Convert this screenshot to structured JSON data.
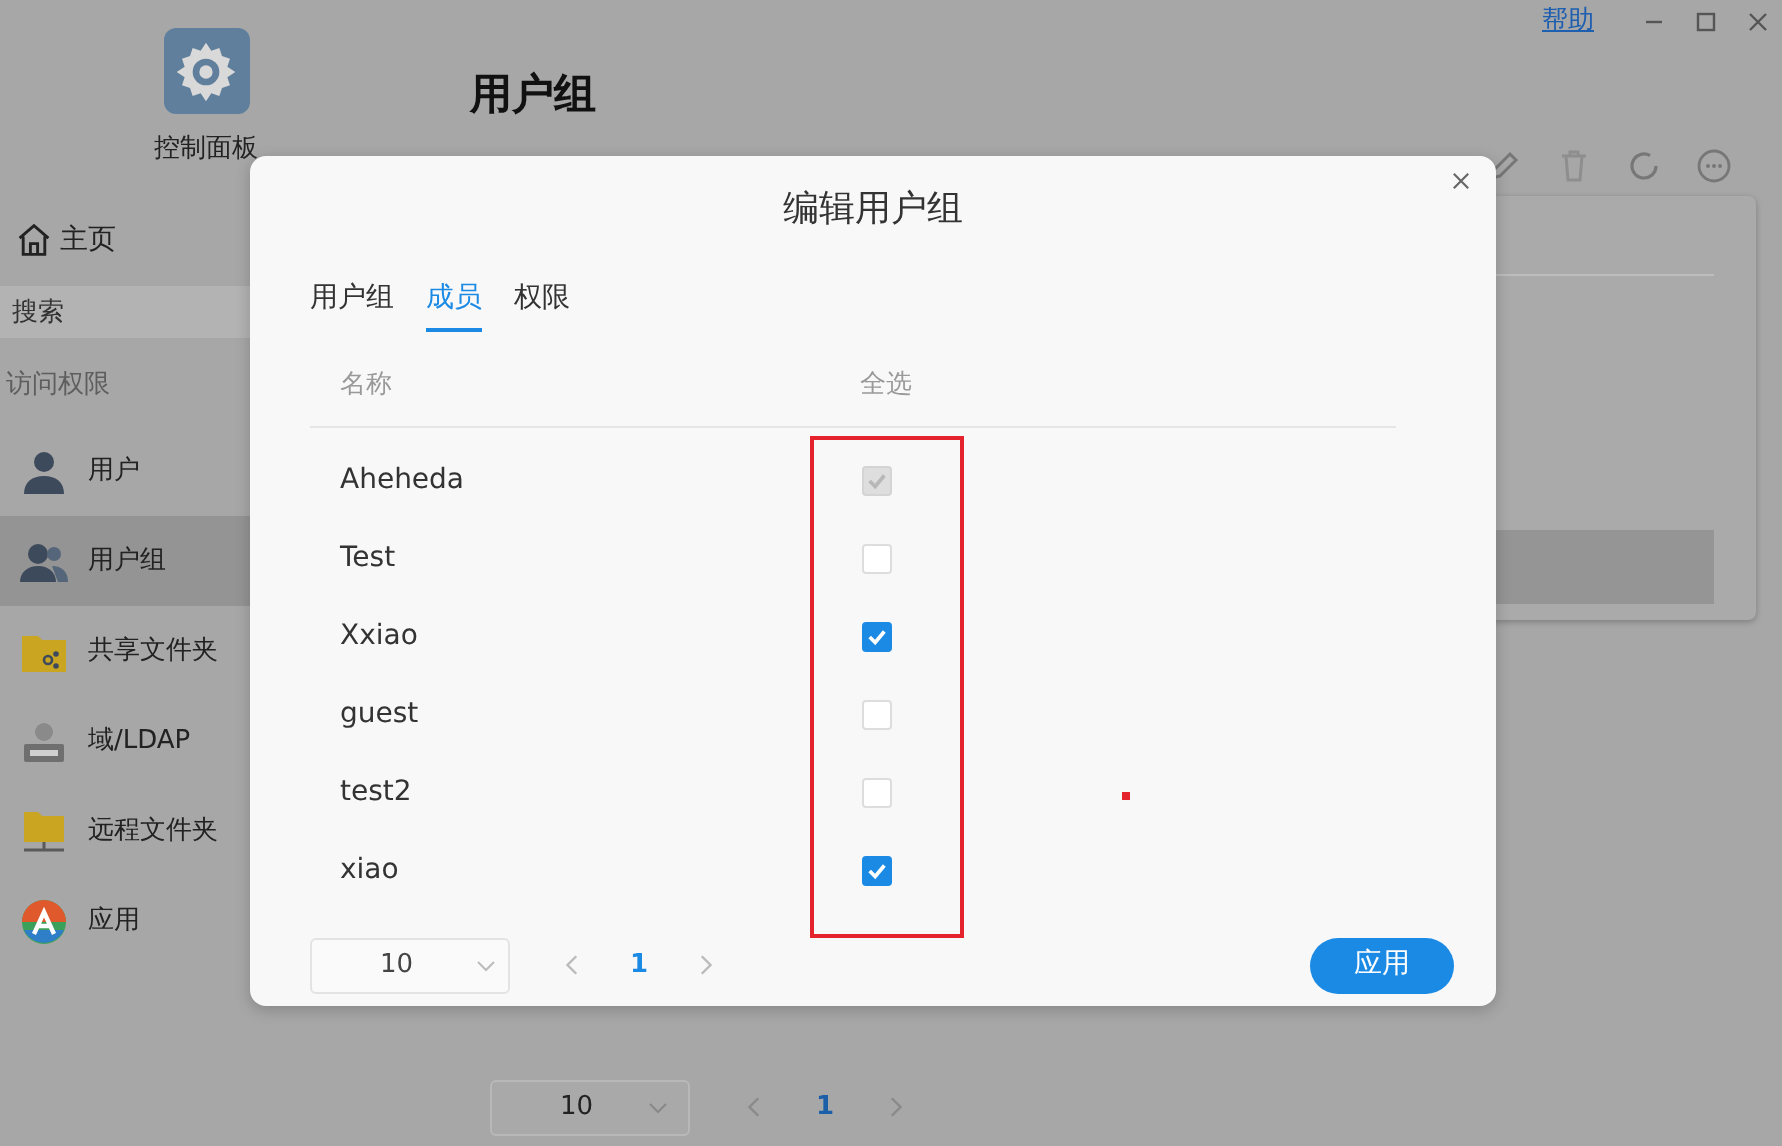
{
  "app": {
    "logo_label": "控制面板",
    "page_title": "用户组",
    "help_link": "帮助"
  },
  "sidebar": {
    "home": "主页",
    "search": {
      "placeholder": "搜索"
    },
    "section": "访问权限",
    "items": [
      {
        "label": "用户",
        "selected": false
      },
      {
        "label": "用户组",
        "selected": true
      },
      {
        "label": "共享文件夹",
        "selected": false
      },
      {
        "label": "域/LDAP",
        "selected": false
      },
      {
        "label": "远程文件夹",
        "selected": false
      },
      {
        "label": "应用",
        "selected": false
      }
    ]
  },
  "background_pager": {
    "page_size": "10",
    "page": "1"
  },
  "dialog": {
    "title": "编辑用户组",
    "tabs": [
      {
        "label": "用户组",
        "selected": false
      },
      {
        "label": "成员",
        "selected": true
      },
      {
        "label": "权限",
        "selected": false
      }
    ],
    "columns": [
      "名称",
      "全选"
    ],
    "members": [
      {
        "name": "Aheheda",
        "checked": true,
        "disabled": true
      },
      {
        "name": "Test",
        "checked": false,
        "disabled": false
      },
      {
        "name": "Xxiao",
        "checked": true,
        "disabled": false
      },
      {
        "name": "guest",
        "checked": false,
        "disabled": false
      },
      {
        "name": "test2",
        "checked": false,
        "disabled": false
      },
      {
        "name": "xiao",
        "checked": true,
        "disabled": false
      }
    ],
    "pager": {
      "page_size": "10",
      "page": "1"
    },
    "apply_button": "应用"
  }
}
